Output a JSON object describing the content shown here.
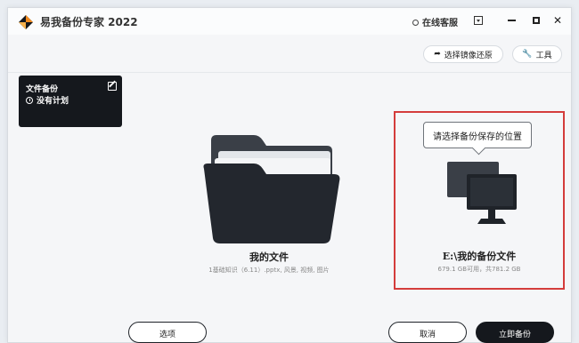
{
  "app": {
    "title": "易我备份专家 2022"
  },
  "titlebar": {
    "online_service": "在线客服"
  },
  "toolbar": {
    "restore_label": "选择镜像还原",
    "tools_label": "工具"
  },
  "plan_card": {
    "title": "文件备份",
    "status": "没有计划"
  },
  "source": {
    "title": "我的文件",
    "subtitle": "1基础知识（6.11）.pptx, 风景, 视频, 图片"
  },
  "destination": {
    "tooltip": "请选择备份保存的位置",
    "title": "E:\\我的备份文件",
    "subtitle": "679.1 GB可用，共781.2 GB"
  },
  "footer": {
    "options_label": "选项",
    "cancel_label": "取消",
    "start_label": "立即备份"
  },
  "colors": {
    "accent_dark": "#15181d",
    "highlight_border": "#d43c3c",
    "logo_orange": "#f28a1d"
  },
  "icons": {
    "logo": "diamond-logo-icon",
    "service": "headset-icon",
    "restore": "restore-arrow-icon",
    "tools": "wrench-icon",
    "edit": "edit-icon",
    "clock": "clock-icon",
    "folder": "folder-icon",
    "computer": "computer-icon"
  }
}
